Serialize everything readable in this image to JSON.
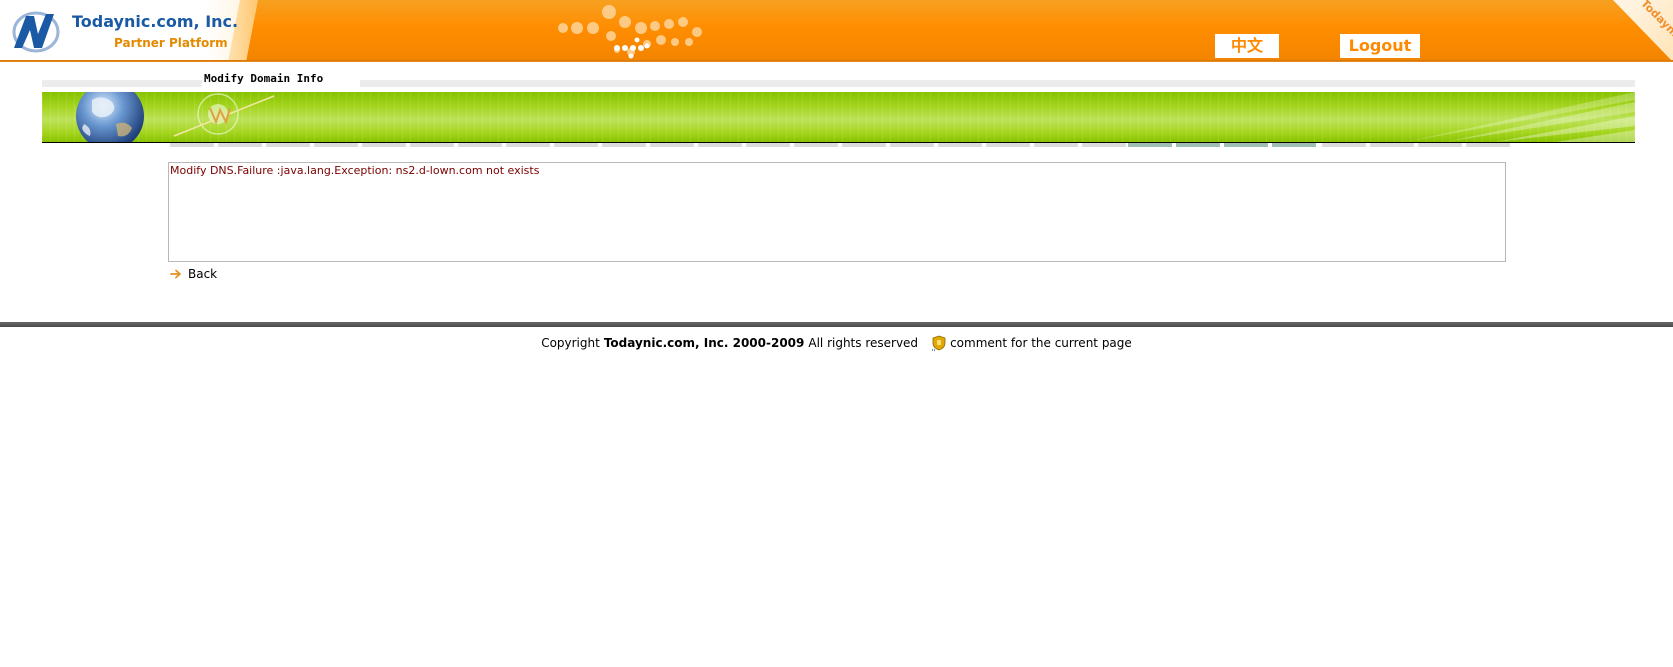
{
  "header": {
    "company": "Todaynic.com, Inc.",
    "platform": "Partner Platform",
    "lang_label": "中文",
    "logout_label": "Logout",
    "corner_text": "Todaynic"
  },
  "page": {
    "title": "Modify Domain Info"
  },
  "message": {
    "text": "Modify DNS.Failure :java.lang.Exception: ns2.d-lown.com not exists",
    "back_label": "Back"
  },
  "footer": {
    "prefix": "Copyright",
    "company": "Todaynic.com, Inc. 2000-2009",
    "reserved": "All rights reserved",
    "comment_label": "comment for the current page"
  },
  "colors": {
    "header_orange": "#ff8d00",
    "banner_green": "#a6d620",
    "error_text": "#7a0000",
    "logo_blue": "#1a5aa5"
  },
  "icons": [
    "todaynic-logo-icon",
    "dots-arrow-icon",
    "globe-icon",
    "sparkle-icon",
    "arrow-right-icon",
    "comment-icon"
  ]
}
